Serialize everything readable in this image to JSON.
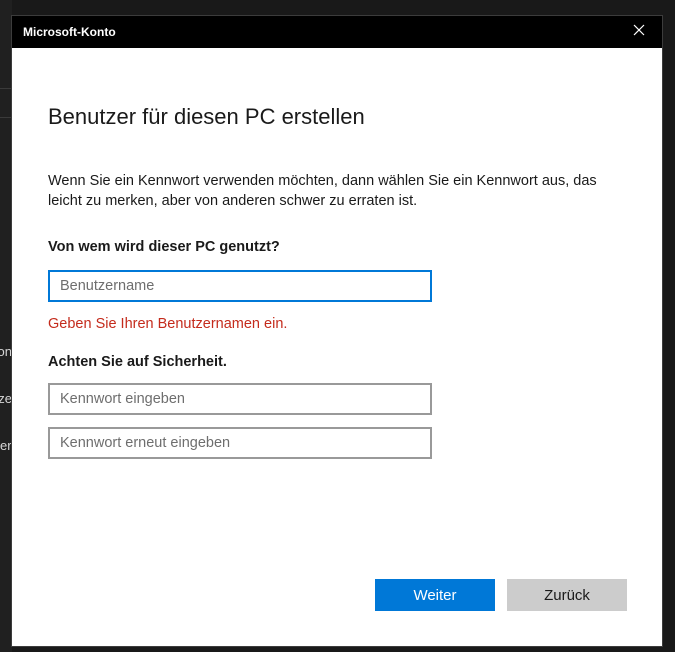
{
  "background": {
    "fragments": [
      "on",
      "ze",
      "er"
    ]
  },
  "dialog": {
    "title": "Microsoft-Konto",
    "heading": "Benutzer für diesen PC erstellen",
    "description": "Wenn Sie ein Kennwort verwenden möchten, dann wählen Sie ein Kennwort aus, das leicht zu merken, aber von anderen schwer zu erraten ist.",
    "user_question": "Von wem wird dieser PC genutzt?",
    "username_placeholder": "Benutzername",
    "username_value": "",
    "error_message": "Geben Sie Ihren Benutzernamen ein.",
    "security_heading": "Achten Sie auf Sicherheit.",
    "password_placeholder": "Kennwort eingeben",
    "password_confirm_placeholder": "Kennwort erneut eingeben",
    "next_label": "Weiter",
    "back_label": "Zurück"
  },
  "colors": {
    "accent": "#0078d7",
    "error": "#c42b1c",
    "titlebar": "#000000"
  },
  "icons": {
    "close": "close-icon"
  }
}
